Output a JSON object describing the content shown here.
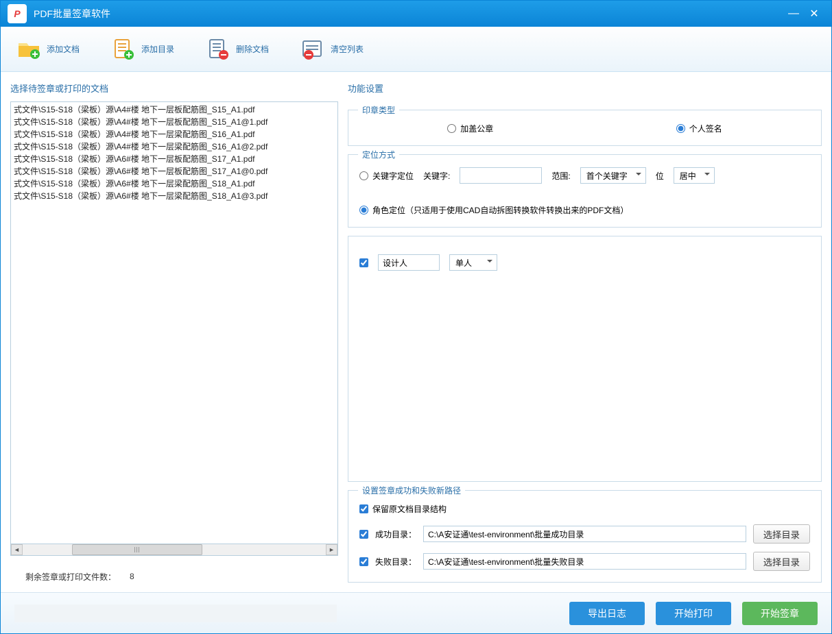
{
  "titlebar": {
    "app_title": "PDF批量签章软件"
  },
  "toolbar": {
    "add_file": "添加文档",
    "add_folder": "添加目录",
    "delete_file": "删除文档",
    "clear_list": "清空列表"
  },
  "left": {
    "title": "选择待签章或打印的文档",
    "files": [
      "式文件\\S15-S18（梁板）源\\A4#楼 地下一层板配筋图_S15_A1.pdf",
      "式文件\\S15-S18（梁板）源\\A4#楼 地下一层板配筋图_S15_A1@1.pdf",
      "式文件\\S15-S18（梁板）源\\A4#楼 地下一层梁配筋图_S16_A1.pdf",
      "式文件\\S15-S18（梁板）源\\A4#楼 地下一层梁配筋图_S16_A1@2.pdf",
      "式文件\\S15-S18（梁板）源\\A6#楼 地下一层板配筋图_S17_A1.pdf",
      "式文件\\S15-S18（梁板）源\\A6#楼 地下一层板配筋图_S17_A1@0.pdf",
      "式文件\\S15-S18（梁板）源\\A6#楼 地下一层梁配筋图_S18_A1.pdf",
      "式文件\\S15-S18（梁板）源\\A6#楼 地下一层梁配筋图_S18_A1@3.pdf"
    ],
    "count_label": "剩余签章或打印文件数：",
    "count_value": "8"
  },
  "right": {
    "title": "功能设置",
    "seal_type": {
      "legend": "印章类型",
      "official": "加盖公章",
      "personal": "个人签名",
      "selected": "personal"
    },
    "locate": {
      "legend": "定位方式",
      "keyword_label": "关键字定位",
      "keyword_field_label": "关键字:",
      "keyword_value": "",
      "range_label": "范围:",
      "range_value": "首个关键字",
      "pos_label": "位",
      "pos_value": "居中",
      "role_label": "角色定位（只适用于使用CAD自动拆图转换软件转换出来的PDF文档）",
      "selected": "role"
    },
    "signer": {
      "role_label": "设计人",
      "mode": "单人",
      "checked": true
    },
    "paths": {
      "legend": "设置签章成功和失败新路径",
      "keep_structure": "保留原文档目录结构",
      "keep_checked": true,
      "success_label": "成功目录：",
      "success_checked": true,
      "success_value": "C:\\A安证通\\test-environment\\批量成功目录",
      "fail_label": "失败目录：",
      "fail_checked": true,
      "fail_value": "C:\\A安证通\\test-environment\\批量失败目录",
      "choose_btn": "选择目录"
    }
  },
  "footer": {
    "export_log": "导出日志",
    "start_print": "开始打印",
    "start_sign": "开始签章"
  }
}
